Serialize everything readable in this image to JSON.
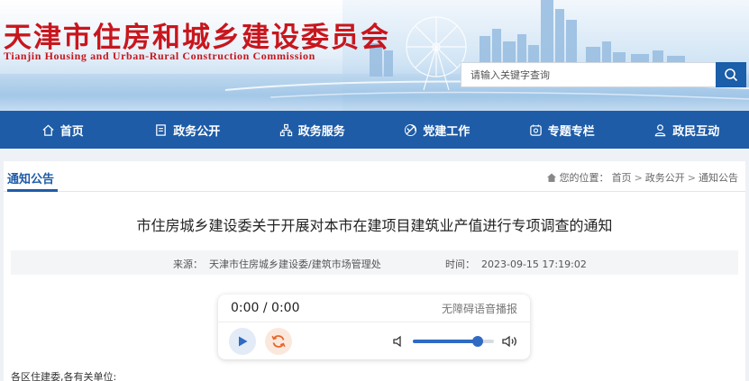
{
  "header": {
    "title": "天津市住房和城乡建设委员会",
    "subtitle": "Tianjin Housing and Urban-Rural Construction Commission",
    "brand_color": "#c8161d"
  },
  "search": {
    "placeholder": "请输入关键字查询",
    "icon": "search-icon"
  },
  "nav": {
    "color": "#1e5ca8",
    "items": [
      {
        "label": "首页",
        "icon": "home-icon"
      },
      {
        "label": "政务公开",
        "icon": "document-icon"
      },
      {
        "label": "政务服务",
        "icon": "org-chart-icon"
      },
      {
        "label": "党建工作",
        "icon": "party-emblem-icon"
      },
      {
        "label": "专题专栏",
        "icon": "column-icon"
      },
      {
        "label": "政民互动",
        "icon": "person-icon"
      }
    ]
  },
  "section": {
    "title": "通知公告"
  },
  "breadcrumb": {
    "prefix": "您的位置：",
    "items": [
      "首页",
      "政务公开",
      "通知公告"
    ],
    "separator": ">"
  },
  "article": {
    "title": "市住房城乡建设委关于开展对本市在建项目建筑业产值进行专项调查的通知",
    "source_label": "来源：",
    "source": "天津市住房城乡建设委/建筑市场管理处",
    "time_label": "时间：",
    "time": "2023-09-15 17:19:02",
    "body_first_line": "各区住建委,各有关单位:"
  },
  "audio_player": {
    "time": "0:00 / 0:00",
    "label": "无障碍语音播报",
    "volume_fraction": 0.8
  }
}
